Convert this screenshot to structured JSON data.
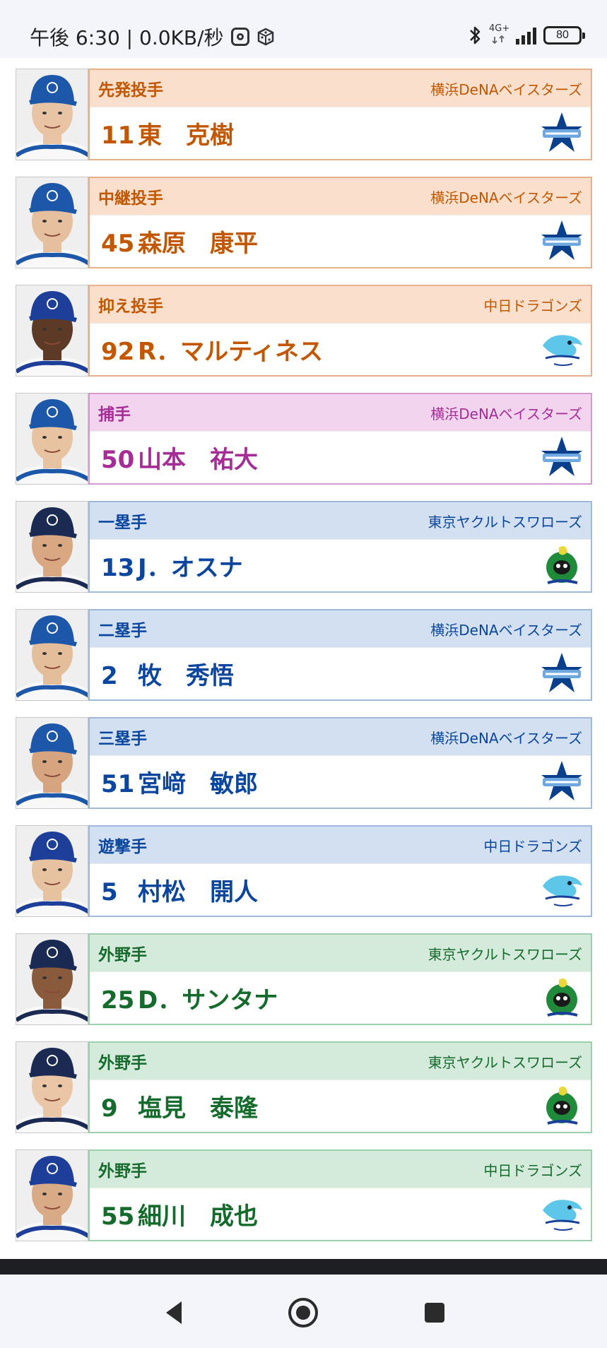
{
  "status_bar": {
    "left_text": "午後 6:30 | 0.0KB/秒",
    "icons": [
      "instagram-icon",
      "dice-icon",
      "bluetooth-icon",
      "network-4g-icon",
      "signal-icon"
    ],
    "network_label": "4G+",
    "battery": "80"
  },
  "players": [
    {
      "position": "先発投手",
      "team": "横浜DeNAベイスターズ",
      "number": "11",
      "name": "東　克樹",
      "role": "pitcher",
      "logo": "baystars",
      "cap": "#1d57a9",
      "skin": "#e9c4a4"
    },
    {
      "position": "中継投手",
      "team": "横浜DeNAベイスターズ",
      "number": "45",
      "name": "森原　康平",
      "role": "pitcher",
      "logo": "baystars",
      "cap": "#1d57a9",
      "skin": "#e6c09e"
    },
    {
      "position": "抑え投手",
      "team": "中日ドラゴンズ",
      "number": "92",
      "name": "R．マルティネス",
      "role": "pitcher",
      "logo": "dragons",
      "cap": "#1d3f99",
      "skin": "#5c3a26"
    },
    {
      "position": "捕手",
      "team": "横浜DeNAベイスターズ",
      "number": "50",
      "name": "山本　祐大",
      "role": "catcher",
      "logo": "baystars",
      "cap": "#1d57a9",
      "skin": "#e7c3a1"
    },
    {
      "position": "一塁手",
      "team": "東京ヤクルトスワローズ",
      "number": "13",
      "name": "J．オスナ",
      "role": "infield",
      "logo": "swallows",
      "cap": "#1b2a52",
      "skin": "#d9a883"
    },
    {
      "position": "二塁手",
      "team": "横浜DeNAベイスターズ",
      "number": "2",
      "name": "牧　秀悟",
      "role": "infield",
      "logo": "baystars",
      "cap": "#1d57a9",
      "skin": "#e4bd9b"
    },
    {
      "position": "三塁手",
      "team": "横浜DeNAベイスターズ",
      "number": "51",
      "name": "宮﨑　敏郎",
      "role": "infield",
      "logo": "baystars",
      "cap": "#1d57a9",
      "skin": "#d6a57f"
    },
    {
      "position": "遊撃手",
      "team": "中日ドラゴンズ",
      "number": "5",
      "name": "村松　開人",
      "role": "infield",
      "logo": "dragons",
      "cap": "#1d3f99",
      "skin": "#e6c2a0"
    },
    {
      "position": "外野手",
      "team": "東京ヤクルトスワローズ",
      "number": "25",
      "name": "D．サンタナ",
      "role": "outfield",
      "logo": "swallows",
      "cap": "#1b2a52",
      "skin": "#8a5a3c"
    },
    {
      "position": "外野手",
      "team": "東京ヤクルトスワローズ",
      "number": "9",
      "name": "塩見　泰隆",
      "role": "outfield",
      "logo": "swallows",
      "cap": "#1b2a52",
      "skin": "#ebc6a6"
    },
    {
      "position": "外野手",
      "team": "中日ドラゴンズ",
      "number": "55",
      "name": "細川　成也",
      "role": "outfield",
      "logo": "dragons",
      "cap": "#1d3f99",
      "skin": "#d8ab86"
    }
  ],
  "nav": {
    "buttons": [
      "back-icon",
      "home-icon",
      "recents-icon"
    ]
  }
}
